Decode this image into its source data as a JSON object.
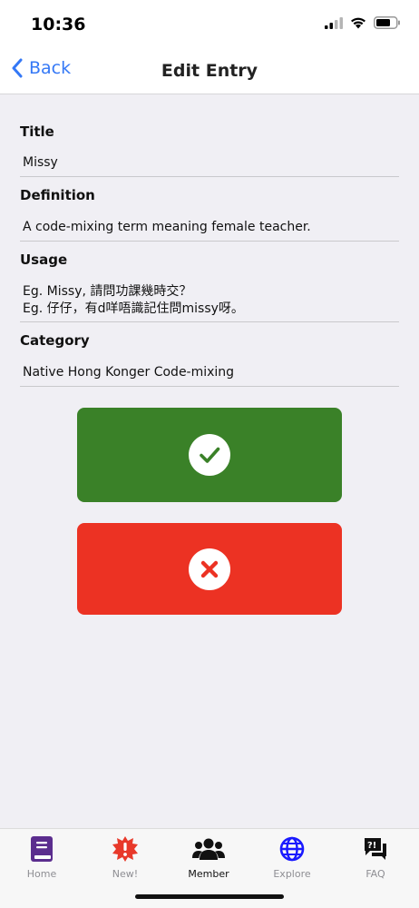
{
  "status_bar": {
    "time": "10:36"
  },
  "nav": {
    "back_label": "Back",
    "title": "Edit Entry"
  },
  "form": {
    "fields": [
      {
        "label": "Title",
        "value": "Missy"
      },
      {
        "label": "Definition",
        "value": "A code-mixing term meaning female teacher."
      },
      {
        "label": "Usage",
        "value": "Eg. Missy, 請問功課幾時交？\nEg. 仔仔，有d咩唔識記住問missy呀。"
      },
      {
        "label": "Category",
        "value": "Native Hong Konger Code-mixing"
      }
    ]
  },
  "buttons": {
    "confirm_icon": "checkmark-icon",
    "cancel_icon": "close-icon",
    "confirm_color": "#3a8128",
    "cancel_color": "#ec3223"
  },
  "tab_bar": {
    "tabs": [
      {
        "label": "Home",
        "icon": "book-icon",
        "color": "#5b2d8e"
      },
      {
        "label": "New!",
        "icon": "new-burst-icon",
        "color": "#e8392a"
      },
      {
        "label": "Member",
        "icon": "group-icon",
        "color": "#111111",
        "active": true
      },
      {
        "label": "Explore",
        "icon": "globe-icon",
        "color": "#1a1aff"
      },
      {
        "label": "FAQ",
        "icon": "faq-icon",
        "color": "#111111"
      }
    ]
  }
}
